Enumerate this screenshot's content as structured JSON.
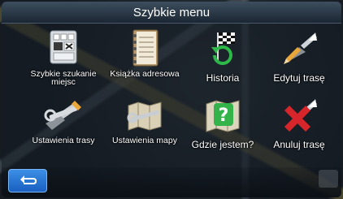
{
  "header": {
    "title": "Szybkie menu"
  },
  "tiles": [
    {
      "label": "Szybkie szukanie miejsc",
      "icon": "keypad-search-icon"
    },
    {
      "label": "Książka adresowa",
      "icon": "address-book-icon"
    },
    {
      "label": "Historia",
      "icon": "history-flag-icon"
    },
    {
      "label": "Edytuj trasę",
      "icon": "edit-route-icon"
    },
    {
      "label": "Ustawienia trasy",
      "icon": "route-settings-icon"
    },
    {
      "label": "Ustawienia mapy",
      "icon": "map-settings-icon"
    },
    {
      "label": "Gdzie jestem?",
      "icon": "where-am-i-icon"
    },
    {
      "label": "Anuluj trasę",
      "icon": "cancel-route-icon"
    }
  ],
  "footer": {
    "back_icon": "back-arrow-icon"
  },
  "colors": {
    "accent": "#2a7bd8",
    "title_bar": "#2b3a4a"
  }
}
